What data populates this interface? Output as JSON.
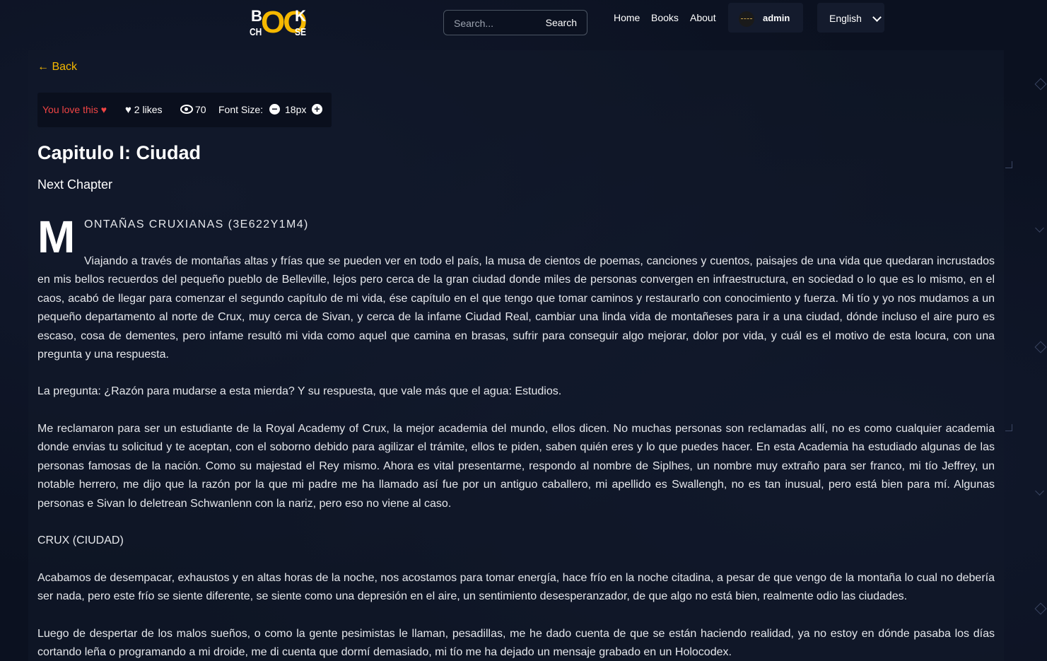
{
  "header": {
    "logo": {
      "b": "B",
      "oo": "OO",
      "k": "K",
      "ch": "CH",
      "se": "SE"
    },
    "search": {
      "placeholder": "Search...",
      "button_label": "Search"
    },
    "nav": {
      "home": "Home",
      "books": "Books",
      "about": "About"
    },
    "user": {
      "name": "admin"
    },
    "language": {
      "selected": "English"
    }
  },
  "toolbar": {
    "back_label": "← Back",
    "love_label": "You love this",
    "likes": "2 likes",
    "views": "70",
    "font_size_label": "Font Size:",
    "font_size_value": "18px",
    "decrease_label": "−",
    "increase_label": "+"
  },
  "chapter": {
    "title": "Capitulo I: Ciudad",
    "next_label": "Next Chapter",
    "dropcap": "M",
    "heading_rest": "ONTAÑAS CRUXIANAS (3E622Y1M4)",
    "paragraphs": [
      "Viajando a través de montañas altas y frías que se pueden ver en todo el país, la musa de cientos de poemas, canciones y cuentos, paisajes de una vida que quedaran incrustados en mis bellos recuerdos del pequeño pueblo de Belleville, lejos pero cerca de la gran ciudad donde miles de personas convergen en infraestructura, en sociedad o lo que es lo mismo, en el caos, acabó de llegar para comenzar el segundo capítulo de mi vida, ése capítulo en el que tengo que tomar caminos y restaurarlo con conocimiento y fuerza. Mi tío y yo nos mudamos a un pequeño departamento al norte de Crux, muy cerca de Sivan, y cerca de la infame Ciudad Real, cambiar una linda vida de montañeses para ir a una ciudad, dónde incluso el aire puro es escaso, cosa de dementes, pero infame resultó mi vida como aquel que camina en brasas, sufrir para conseguir algo mejorar, dolor por vida, y cuál es el motivo de esta locura, con una pregunta y una respuesta.",
      "La pregunta: ¿Razón para mudarse a esta mierda? Y su respuesta, que vale más que el agua: Estudios.",
      "Me reclamaron para ser un estudiante de la Royal Academy of Crux, la mejor academia del mundo, ellos dicen. No muchas personas son reclamadas allí, no es como cualquier academia donde envias tu solicitud y te aceptan, con el soborno debido para agilizar el trámite, ellos te piden, saben quién eres y lo que puedes hacer. En esta Academia ha estudiado algunas de las personas famosas de la nación. Como su majestad el Rey mismo. Ahora es vital presentarme, respondo al nombre de Siplhes, un nombre muy extraño para ser franco, mi tío Jeffrey, un notable herrero, me dijo que la razón por la que mi padre me ha llamado así fue por un antiguo caballero, mi apellido es Swallengh, no es tan inusual, pero está bien para mí. Algunas personas e Sivan lo deletrean Schwanlenn con la nariz, pero eso no viene al caso.",
      "CRUX (CIUDAD)",
      "Acabamos de desempacar, exhaustos y en altas horas de la noche, nos acostamos para tomar energía, hace frío en la noche citadina, a pesar de que vengo de la montaña lo cual no debería ser nada, pero este frío se siente diferente, se siente como una depresión en el aire, un sentimiento desesperanzador, de que algo no está bien, realmente odio las ciudades.",
      "Luego de despertar de los malos sueños, o como la gente pesimistas le llaman, pesadillas, me he dado cuenta de que se están haciendo realidad, ya no estoy en dónde pasaba los días cortando leña o programando a mi droide, me di cuenta que dormí demasiado, mi tío me ha dejado un mensaje grabado en un Holocodex."
    ]
  },
  "colors": {
    "accent": "#f5b800",
    "love": "#ef4444",
    "background": "#0b1120"
  },
  "icons": {
    "heart": "♥",
    "heart_outline": "♥"
  }
}
